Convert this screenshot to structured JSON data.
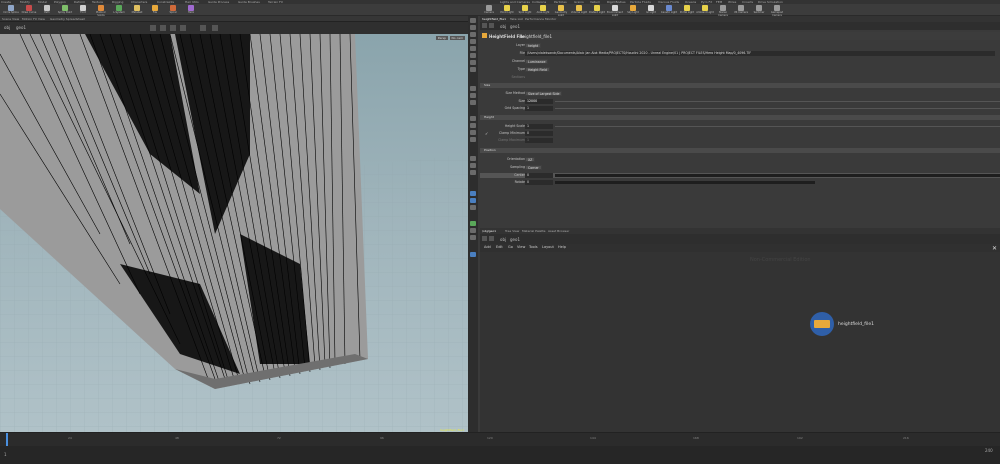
{
  "shelf": {
    "tabs": [
      "Create",
      "Modify",
      "Model",
      "Polygon",
      "Deform",
      "Texture",
      "Rigging",
      "Characters",
      "Constraints",
      "Hair Utils",
      "Guide Process",
      "Guide Brushes",
      "Terrain FX"
    ],
    "tools": [
      "Circle Spline",
      "Draw Curve",
      "Path",
      "Spray Paint",
      "Font",
      "Platonic Solids",
      "L-System",
      "Metaball",
      "File",
      "Spiral",
      "Helix"
    ]
  },
  "right_shelf": {
    "tabs": [
      "Lights and Cameras",
      "Collisions",
      "Particles",
      "Grains",
      "Vellum",
      "Rigid Bodies",
      "Particle Fluids",
      "Viscous Fluids",
      "Oceans",
      "Pyro FX",
      "FEM",
      "Wires",
      "Crowds",
      "Drive Simulation"
    ],
    "tools": [
      "Camera",
      "Point Light",
      "Spot Light",
      "Area Light",
      "Geometry Light",
      "Volume Light",
      "Distant Light",
      "Environment Light",
      "Sky Light",
      "GI Light",
      "Caustic Light",
      "Portal Light",
      "Ambient Light",
      "Stereo Camera",
      "VR Camera",
      "Switcher",
      "Gamepad Camera"
    ]
  },
  "viewport": {
    "tabs": [
      "Scene View",
      "Motion FX View",
      "Geometry Spreadsheet"
    ],
    "path": "obj",
    "node": "geo1",
    "persp_label": "Persp",
    "cam_label": "No cam",
    "corner_note": "heightfield_file1"
  },
  "params": {
    "tabs": [
      "heightfield_file1",
      "Take List",
      "Performance Monitor"
    ],
    "path_obj": "obj",
    "path_node": "geo1",
    "node_type": "HeightField File",
    "node_name": "heightfield_file1",
    "layer_label": "Layer",
    "layer_value": "height",
    "file_label": "File",
    "file_value": "/Users/vlaleksandr/Documents/Alaic Jan Alot Media/PROJECTS/Houdini 2020 - Unreal Engine/01 | PROJECT FILES/Hero Height Map/0_4096.TIF",
    "channel_label": "Channel",
    "channel_value": "Luminance",
    "type_label": "Type",
    "type_value": "Height Field",
    "uv_label": "Sections",
    "size_section": "Size",
    "size_method_label": "Size Method",
    "size_method_value": "Size of Largest Side",
    "size_label": "Size",
    "size_value": "12000",
    "grid_spacing_label": "Grid Spacing",
    "grid_spacing_value": "1",
    "height_section": "Height",
    "height_scale_label": "Height Scale",
    "height_scale_value": "1",
    "clamp_min_label": "Clamp Minimum",
    "clamp_min_value": "0",
    "clamp_max_label": "Clamp Maximum",
    "clamp_max_value": "1",
    "position_section": "Position",
    "orientation_label": "Orientation",
    "orientation_value": "XZ",
    "sampling_label": "Sampling",
    "sampling_value": "Corner",
    "center_label": "Center",
    "center_value": "0",
    "rotate_label": "Rotate",
    "rotate_value": "0"
  },
  "network": {
    "tabs": [
      "/obj/geo1",
      "Tree View",
      "Material Palette",
      "Asset Browser"
    ],
    "path_obj": "obj",
    "path_node": "geo1",
    "menu": [
      "Add",
      "Edit",
      "Go",
      "View",
      "Tools",
      "Layout",
      "Help"
    ],
    "watermark": "Non-Commercial Edition",
    "node_label": "heightfield_file1"
  },
  "timeline": {
    "ticks": [
      "24",
      "48",
      "72",
      "96",
      "120",
      "144",
      "168",
      "192",
      "216",
      "240"
    ],
    "frame": "1",
    "end_frame": "240"
  },
  "colors": {
    "accent": "#e8a93b",
    "node_ring": "#2f5fa8",
    "selected_row": "#555555"
  }
}
